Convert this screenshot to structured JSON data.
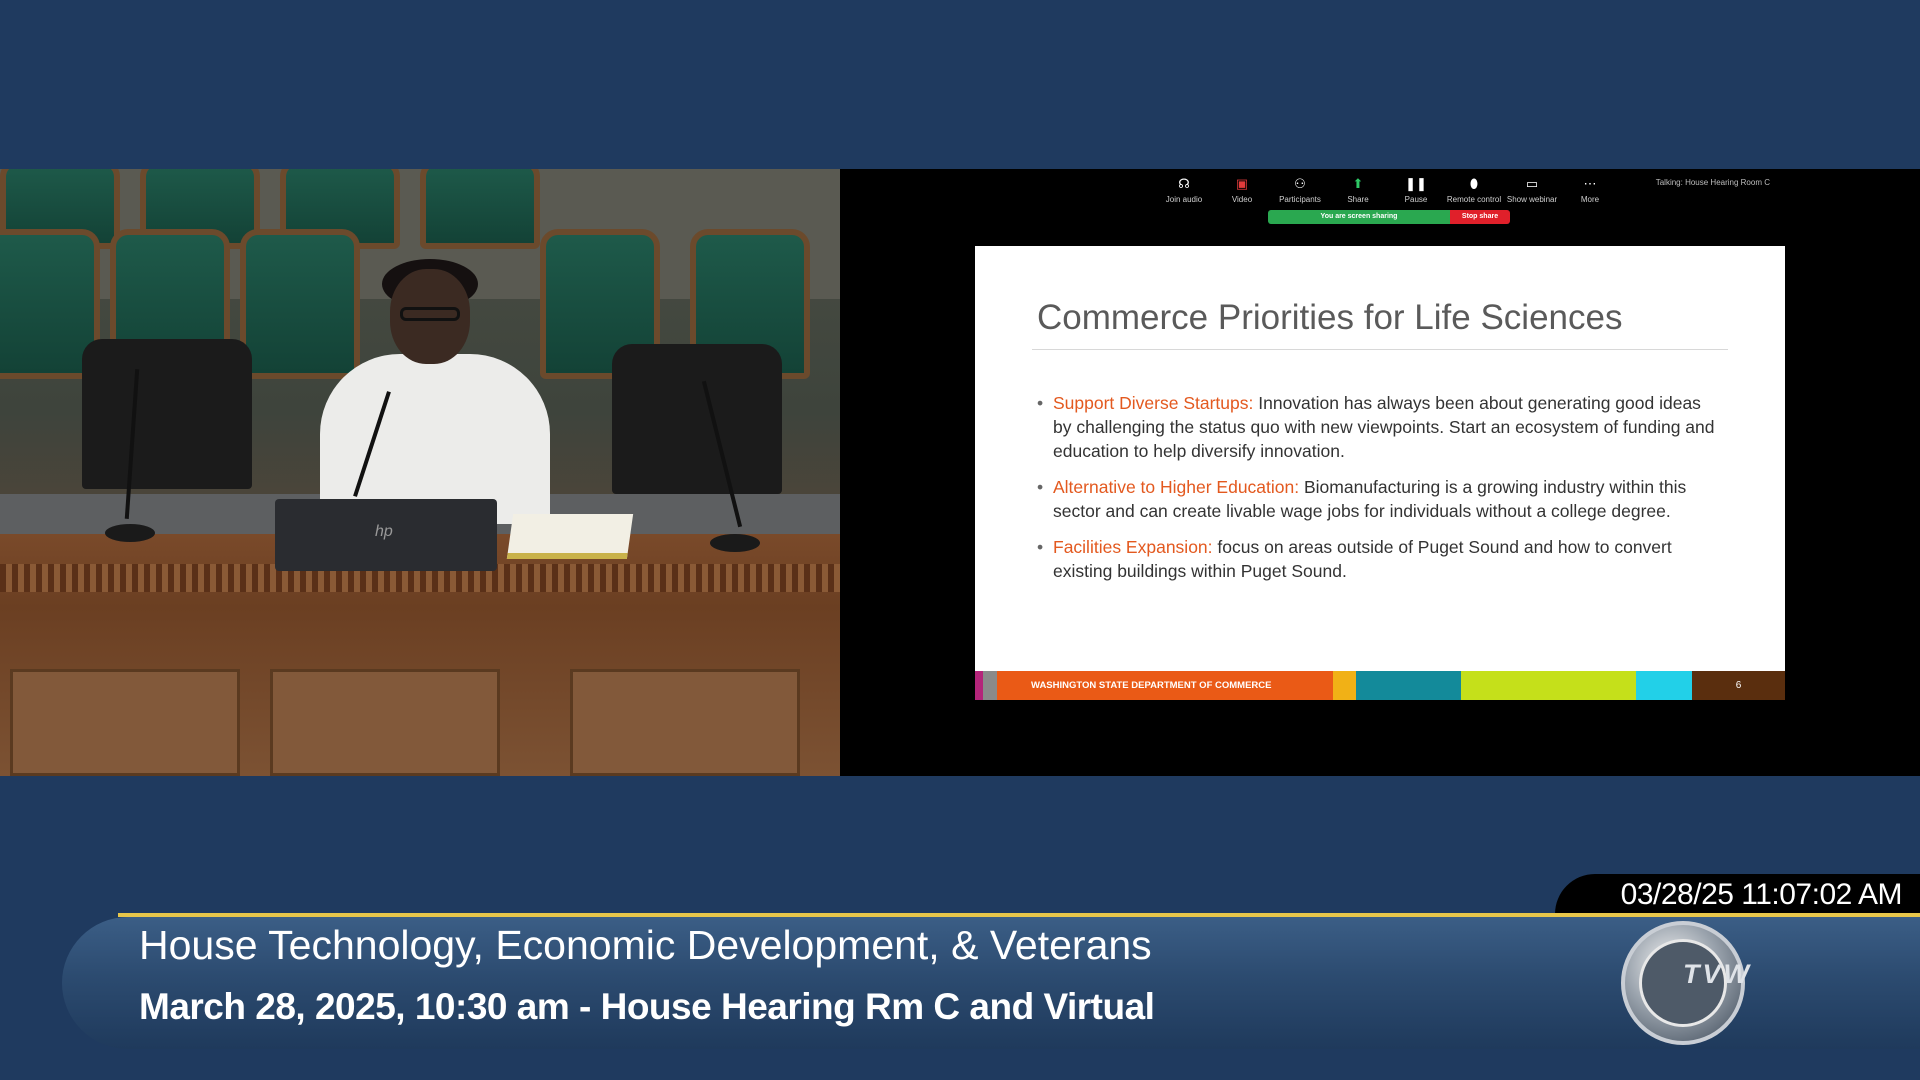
{
  "zoom": {
    "toolbar": [
      {
        "icon": "headphones-icon",
        "glyph": "☊",
        "label": "Join audio"
      },
      {
        "icon": "video-icon",
        "glyph": "▣",
        "label": "Video"
      },
      {
        "icon": "participants-icon",
        "glyph": "⚇",
        "label": "Participants"
      },
      {
        "icon": "share-icon",
        "glyph": "⬆",
        "label": "Share"
      },
      {
        "icon": "pause-icon",
        "glyph": "❚❚",
        "label": "Pause"
      },
      {
        "icon": "remote-control-icon",
        "glyph": "⬮",
        "label": "Remote control"
      },
      {
        "icon": "show-webinar-icon",
        "glyph": "▭",
        "label": "Show webinar"
      },
      {
        "icon": "more-icon",
        "glyph": "⋯",
        "label": "More"
      }
    ],
    "talking": "Talking: House Hearing Room C",
    "sharing_label": "You are screen sharing",
    "stop_share_label": "Stop share"
  },
  "slide": {
    "title": "Commerce Priorities for Life Sciences",
    "bullets": [
      {
        "head": "Support Diverse Startups:",
        "body": " Innovation has always been about generating good ideas by challenging the status quo with new viewpoints. Start an ecosystem of funding and education to help diversify innovation."
      },
      {
        "head": "Alternative to Higher Education:",
        "body": " Biomanufacturing is a growing industry within this sector and can create livable wage jobs for individuals without a college degree."
      },
      {
        "head": "Facilities Expansion:",
        "body": " focus on areas outside of Puget Sound and how to convert existing buildings within Puget Sound."
      }
    ],
    "footer_text": "WASHINGTON STATE DEPARTMENT OF COMMERCE",
    "page_number": "6",
    "footer_colors": {
      "magenta": "#b4257a",
      "gray": "#8a8a8a",
      "orange": "#ea5a16",
      "amber": "#f1b116",
      "teal": "#138a9a",
      "lime": "#c5e01a",
      "cyan": "#22d0e8",
      "brown": "#5a2e0e"
    }
  },
  "broadcast": {
    "timestamp": "03/28/25 11:07:02 AM",
    "title": "House Technology, Economic Development, & Veterans",
    "subtitle": "March 28, 2025, 10:30 am - House Hearing Rm C and Virtual",
    "logo_text": "TVW"
  }
}
